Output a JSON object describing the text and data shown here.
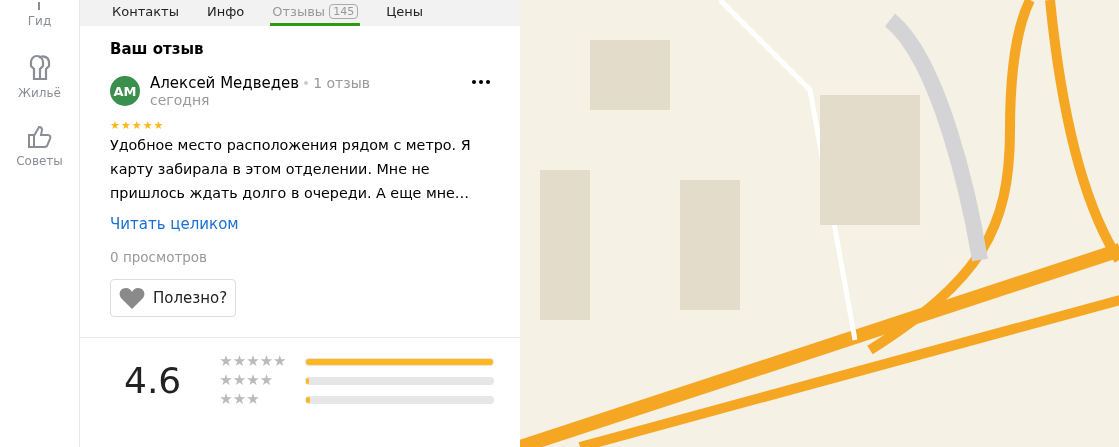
{
  "sidebar": {
    "items": [
      {
        "label": "Гид"
      },
      {
        "label": "Жильё"
      },
      {
        "label": "Советы"
      }
    ]
  },
  "tabs": [
    {
      "label": "Контакты",
      "selected": false
    },
    {
      "label": "Инфо",
      "selected": false
    },
    {
      "label": "Отзывы",
      "count": "145",
      "selected": true
    },
    {
      "label": "Цены",
      "selected": false
    }
  ],
  "review": {
    "heading": "Ваш отзыв",
    "avatar": "АМ",
    "author": "Алексей Медведев",
    "author_reviews": "1 отзыв",
    "date": "сегодня",
    "stars": 5,
    "text": "Удобное место расположения рядом с метро. Я карту забирала в этом отделении. Мне не пришлось ждать долго в очереди. А еще мне…",
    "read_more": "Читать целиком",
    "views": "0 просмотров",
    "useful_button": "Полезно?"
  },
  "rating": {
    "value": "4.6",
    "rows": [
      {
        "stars": 5,
        "level": 1.0
      },
      {
        "stars": 4,
        "level": 0.01
      },
      {
        "stars": 3,
        "level": 0.02
      }
    ]
  }
}
